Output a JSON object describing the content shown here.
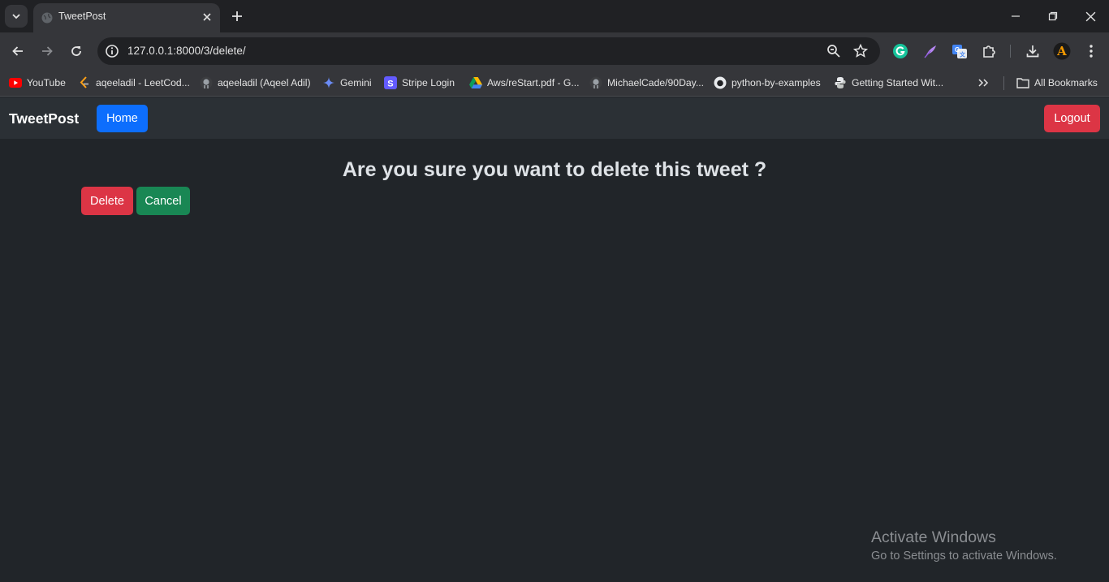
{
  "browser": {
    "tab": {
      "title": "TweetPost"
    },
    "address_bar": {
      "url": "127.0.0.1:8000/3/delete/"
    },
    "bookmarks": [
      {
        "label": "YouTube",
        "icon": "youtube-icon"
      },
      {
        "label": "aqeeladil - LeetCod...",
        "icon": "leetcode-icon"
      },
      {
        "label": "aqeeladil (Aqeel Adil)",
        "icon": "github-icon"
      },
      {
        "label": "Gemini",
        "icon": "gemini-icon"
      },
      {
        "label": "Stripe Login",
        "icon": "stripe-icon"
      },
      {
        "label": "Aws/reStart.pdf - G...",
        "icon": "google-drive-icon"
      },
      {
        "label": "MichaelCade/90Day...",
        "icon": "github-icon"
      },
      {
        "label": "python-by-examples",
        "icon": "github-icon"
      },
      {
        "label": "Getting Started Wit...",
        "icon": "python-icon"
      }
    ],
    "all_bookmarks_label": "All Bookmarks",
    "profile_initial": "A"
  },
  "app": {
    "brand": "TweetPost",
    "nav": {
      "home_label": "Home",
      "logout_label": "Logout"
    },
    "confirm": {
      "title": "Are you sure you want to delete this tweet ?",
      "delete_label": "Delete",
      "cancel_label": "Cancel"
    }
  },
  "watermark": {
    "title": "Activate Windows",
    "subtitle": "Go to Settings to activate Windows."
  },
  "colors": {
    "page_bg": "#212529",
    "navbar_bg": "#2b3035",
    "primary": "#0d6efd",
    "danger": "#dc3545",
    "success": "#198754"
  }
}
